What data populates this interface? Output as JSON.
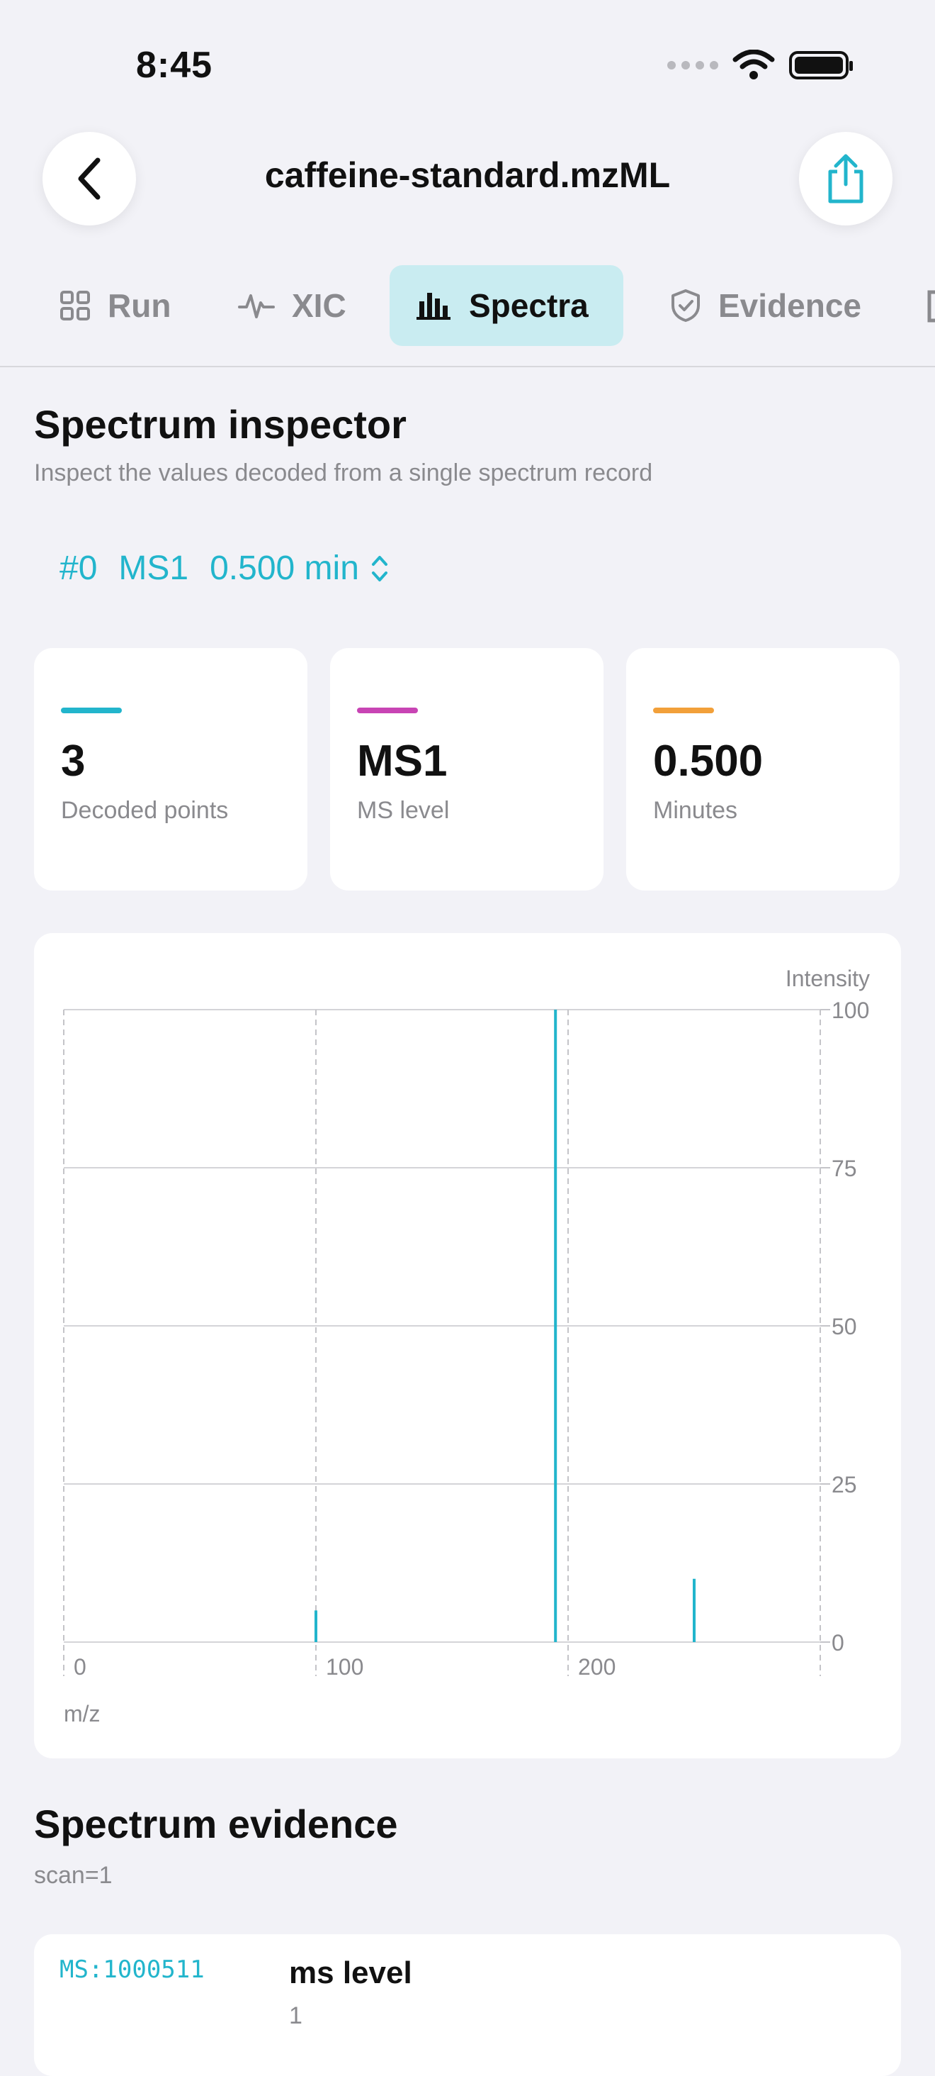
{
  "status": {
    "time": "8:45"
  },
  "nav": {
    "title": "caffeine-standard.mzML"
  },
  "tabs": [
    {
      "label": "Run",
      "icon": "grid-icon"
    },
    {
      "label": "XIC",
      "icon": "waveform-icon"
    },
    {
      "label": "Spectra",
      "icon": "bar-chart-icon",
      "active": true
    },
    {
      "label": "Evidence",
      "icon": "shield-check-icon"
    }
  ],
  "inspector": {
    "title": "Spectrum inspector",
    "subtitle": "Inspect the values decoded from a single spectrum record",
    "picker": {
      "index": "#0",
      "level": "MS1",
      "time": "0.500 min"
    }
  },
  "stats": [
    {
      "value": "3",
      "label": "Decoded points",
      "color": "#22b5cc"
    },
    {
      "value": "MS1",
      "label": "MS level",
      "color": "#c844b4"
    },
    {
      "value": "0.500",
      "label": "Minutes",
      "color": "#f2a03a"
    }
  ],
  "chart_data": {
    "type": "bar",
    "xlabel": "m/z",
    "ylabel": "Intensity",
    "xlim": [
      0,
      300
    ],
    "ylim": [
      0,
      100
    ],
    "xticks": [
      0,
      100,
      200
    ],
    "yticks": [
      0,
      25,
      50,
      75,
      100
    ],
    "grid": true,
    "color": "#22b5cc",
    "x": [
      100,
      195,
      250
    ],
    "values": [
      5,
      100,
      10
    ]
  },
  "evidence": {
    "title": "Spectrum evidence",
    "subtitle": "scan=1",
    "items": [
      {
        "code": "MS:1000511",
        "name": "ms level",
        "value": "1"
      }
    ]
  }
}
